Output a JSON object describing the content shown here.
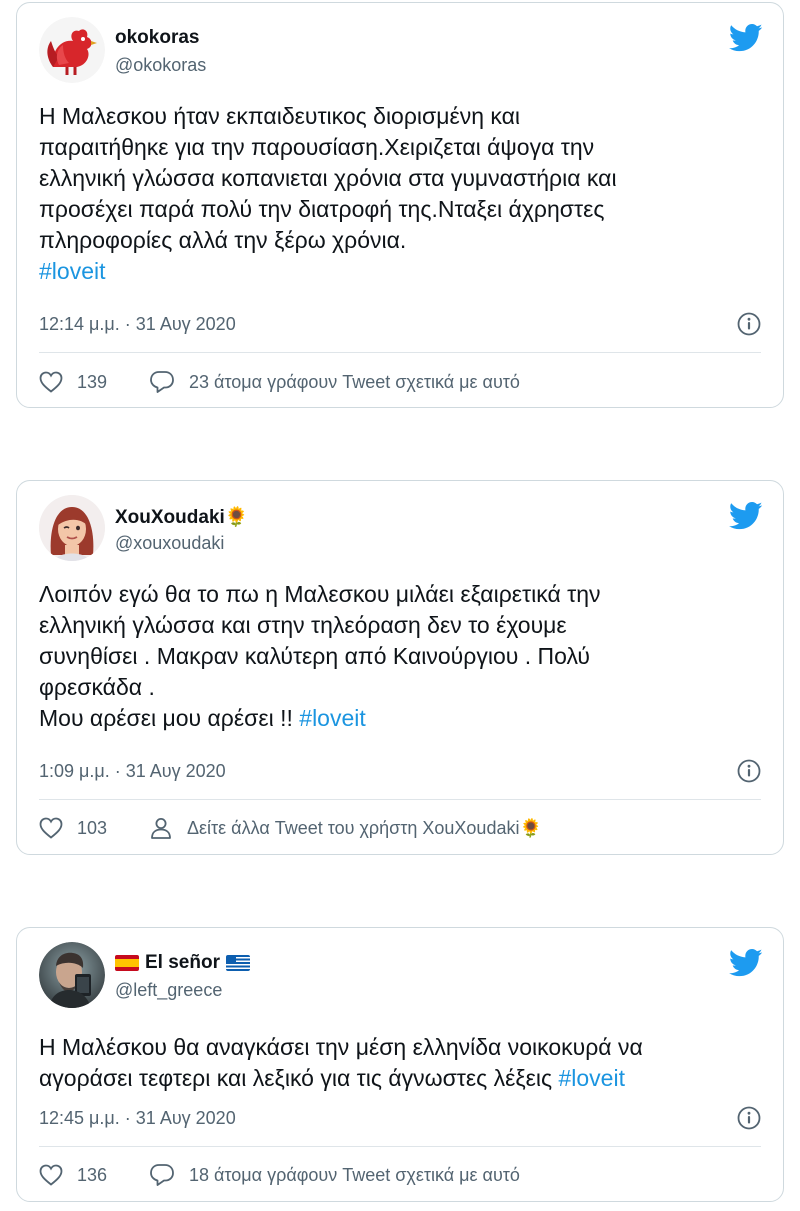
{
  "colors": {
    "twitter_blue": "#1d9bf0",
    "hashtag": "#1b95e0",
    "secondary_text": "#536471",
    "border": "#cfd9de"
  },
  "tweets": [
    {
      "name": "okokoras",
      "handle": "@okokoras",
      "text": "Η Μαλεσκου ήταν εκπαιδευτικος διορισμένη και\nπαραιτήθηκε για την παρουσίαση.Χειριζεται άψογα την\nελληνική γλώσσα κοπανιεται χρόνια στα γυμναστήρια και\nπροσέχει παρά πολύ την διατροφή της.Νταξει άχρηστες\nπληροφορίες αλλά την ξέρω χρόνια.",
      "hashtag": "#loveit",
      "timestamp": "12:14 μ.μ. · 31 Αυγ 2020",
      "likes": "139",
      "action_text": "23 άτομα γράφουν Tweet σχετικά με αυτό",
      "action_icon": "reply-icon"
    },
    {
      "name": "XouXoudaki🌻",
      "handle": "@xouxoudaki",
      "text": "Λοιπόν εγώ θα το πω η Μαλεσκου μιλάει εξαιρετικά την\nελληνική  γλώσσα και στην τηλεόραση δεν το έχουμε\nσυνηθίσει . Μακραν καλύτερη από Καινούργιου . Πολύ\nφρεσκάδα .\nΜου αρέσει μου αρέσει !! ",
      "hashtag": "#loveit",
      "timestamp": "1:09 μ.μ. · 31 Αυγ 2020",
      "likes": "103",
      "action_text": "Δείτε άλλα Tweet του χρήστη XouXoudaki🌻",
      "action_icon": "user-icon"
    },
    {
      "name": "El señor",
      "handle": "@left_greece",
      "text": "Η Μαλέσκου θα αναγκάσει την μέση ελληνίδα νοικοκυρά να\nαγοράσει τεφτερι και λεξικό για τις άγνωστες λέξεις ",
      "hashtag": "#loveit",
      "timestamp": "12:45 μ.μ. · 31 Αυγ 2020",
      "likes": "136",
      "action_text": "18 άτομα γράφουν Tweet σχετικά με αυτό",
      "action_icon": "reply-icon"
    }
  ]
}
